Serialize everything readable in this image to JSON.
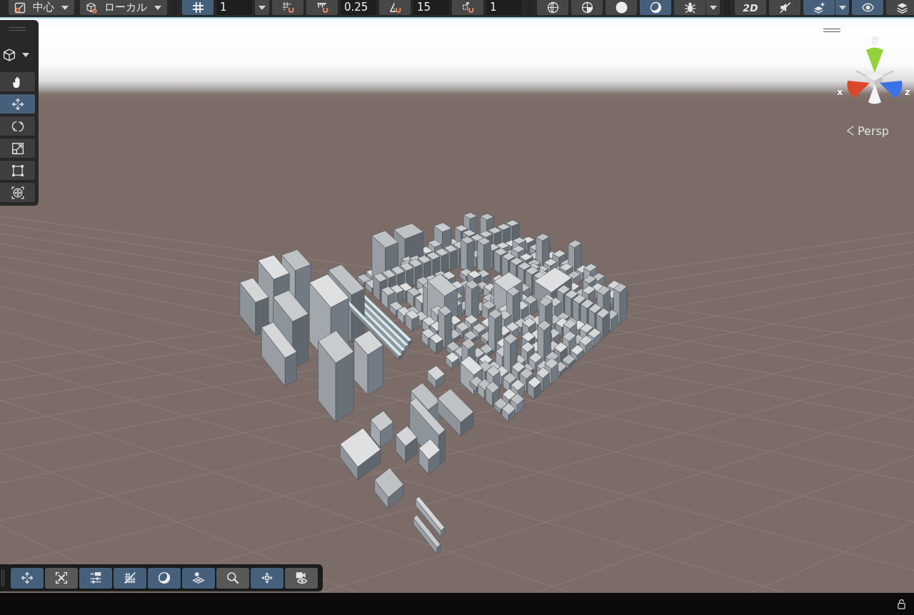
{
  "top_toolbar": {
    "groups": [
      {
        "items": [
          {
            "kind": "dropdown",
            "label": "中心"
          },
          {
            "kind": "dropdown",
            "label": "ローカル"
          }
        ]
      },
      {
        "items": [
          {
            "kind": "toggle",
            "on": true
          },
          {
            "kind": "field",
            "value": "1"
          },
          {
            "kind": "caret",
            "on": false
          },
          {
            "kind": "toggle",
            "on": false
          },
          {
            "kind": "toggle",
            "on": false
          },
          {
            "kind": "field",
            "value": "0.25"
          },
          {
            "kind": "toggle",
            "on": false
          },
          {
            "kind": "field",
            "value": "15"
          },
          {
            "kind": "toggle",
            "on": false
          },
          {
            "kind": "field",
            "value": "1"
          }
        ]
      },
      {
        "items": [
          {
            "kind": "toggle",
            "on": false
          },
          {
            "kind": "toggle",
            "on": false
          },
          {
            "kind": "toggle",
            "on": false
          },
          {
            "kind": "toggle",
            "on": true
          },
          {
            "kind": "toggle",
            "on": false
          },
          {
            "kind": "caret",
            "on": false
          }
        ]
      },
      {
        "items": [
          {
            "kind": "toggle",
            "label": "2D",
            "on": false
          },
          {
            "kind": "toggle",
            "on": false
          },
          {
            "kind": "toggle",
            "on": true
          },
          {
            "kind": "caret",
            "on": true
          },
          {
            "kind": "toggle",
            "on": true
          },
          {
            "kind": "toggle",
            "on": false
          }
        ]
      }
    ]
  },
  "tool_overlay": {
    "tools": [
      {
        "selected": false
      },
      {
        "selected": true
      },
      {
        "selected": false
      },
      {
        "selected": false
      },
      {
        "selected": false
      },
      {
        "selected": false
      }
    ]
  },
  "orientation_gizmo": {
    "axes": [
      {
        "label": "x",
        "color": "#d9482b"
      },
      {
        "label": "y",
        "color": "#93d23a"
      },
      {
        "label": "z",
        "color": "#3b72e6"
      }
    ],
    "projection": "Persp"
  },
  "bottom_overlay": {
    "toggles": [
      {
        "on": true
      },
      {
        "on": false
      },
      {
        "on": true
      },
      {
        "on": true
      },
      {
        "on": true
      },
      {
        "on": true
      },
      {
        "on": false
      },
      {
        "on": true
      },
      {
        "on": false
      }
    ]
  }
}
